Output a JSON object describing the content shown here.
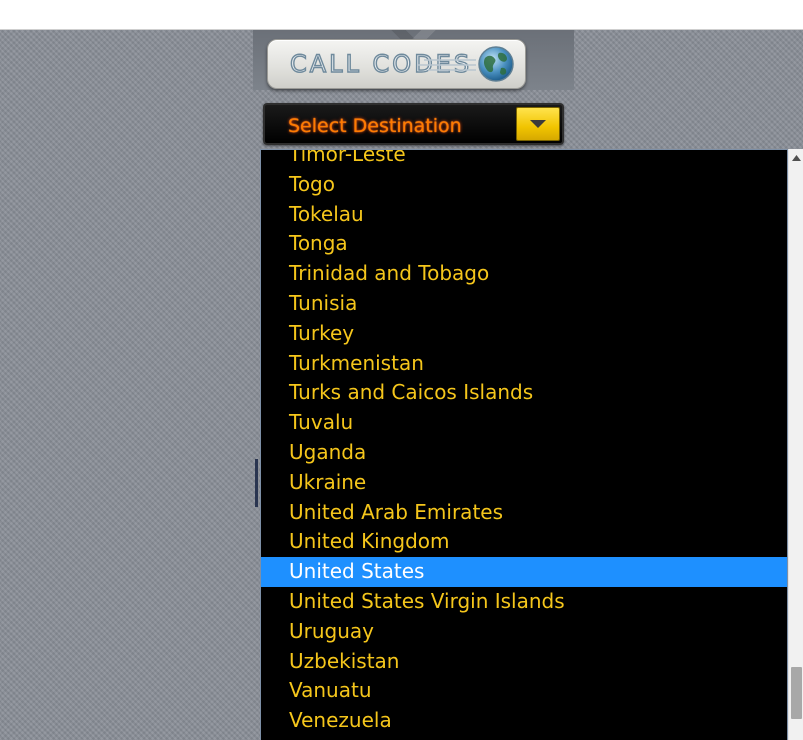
{
  "app": {
    "logo_text": "CALL CODES"
  },
  "selector": {
    "label": "Select Destination",
    "icon": "chevron-down-icon"
  },
  "dropdown": {
    "items": [
      "Timor-Leste",
      "Togo",
      "Tokelau",
      "Tonga",
      "Trinidad and Tobago",
      "Tunisia",
      "Turkey",
      "Turkmenistan",
      "Turks and Caicos Islands",
      "Tuvalu",
      "Uganda",
      "Ukraine",
      "United Arab Emirates",
      "United Kingdom",
      "United States",
      "United States Virgin Islands",
      "Uruguay",
      "Uzbekistan",
      "Vanuatu",
      "Venezuela"
    ],
    "selected_index": 14
  },
  "colors": {
    "item_text": "#f5c61b",
    "selected_bg": "#1e90ff",
    "selected_text": "#ffffff",
    "select_label": "#ff7a00",
    "arrow_button": "#f1c400"
  }
}
